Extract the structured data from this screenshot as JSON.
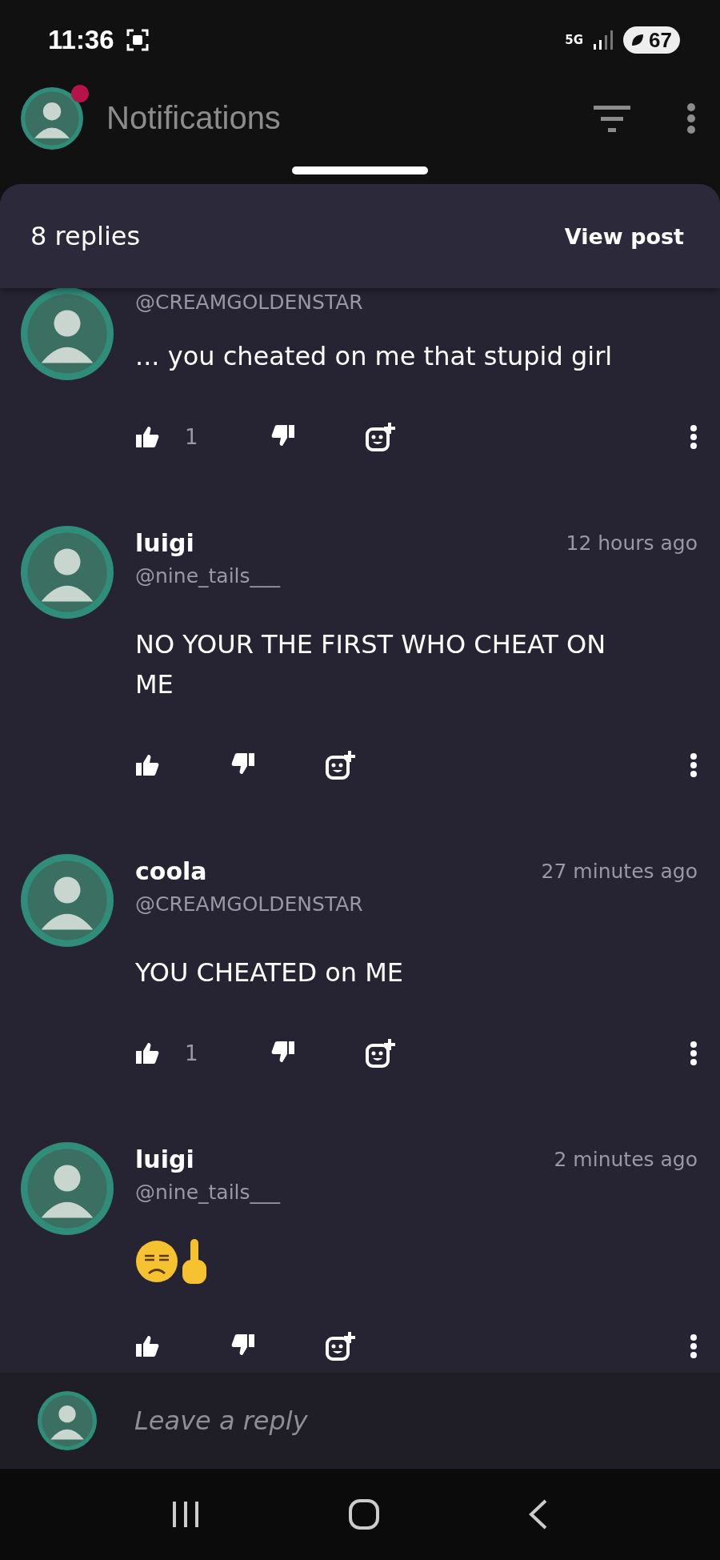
{
  "status_bar": {
    "time": "11:36",
    "network": "5G",
    "battery": "67"
  },
  "app_bar": {
    "title": "Notifications",
    "unread": true
  },
  "sheet": {
    "title": "8 replies",
    "action": "View post"
  },
  "comments": [
    {
      "handle": "@CREAMGOLDENSTAR",
      "body": "... you cheated on me that stupid girl",
      "likes": "1",
      "kind": "text"
    },
    {
      "name": "luigi",
      "handle": "@nine_tails___",
      "time": "12 hours ago",
      "body": "NO YOUR THE FIRST WHO CHEAT ON ME",
      "kind": "text"
    },
    {
      "name": "coola",
      "handle": "@CREAMGOLDENSTAR",
      "time": "27 minutes ago",
      "body": "YOU CHEATED on ME",
      "likes": "1",
      "kind": "text"
    },
    {
      "name": "luigi",
      "handle": "@nine_tails___",
      "time": "2 minutes ago",
      "kind": "emoji"
    }
  ],
  "reply_bar": {
    "placeholder": "Leave a reply"
  }
}
